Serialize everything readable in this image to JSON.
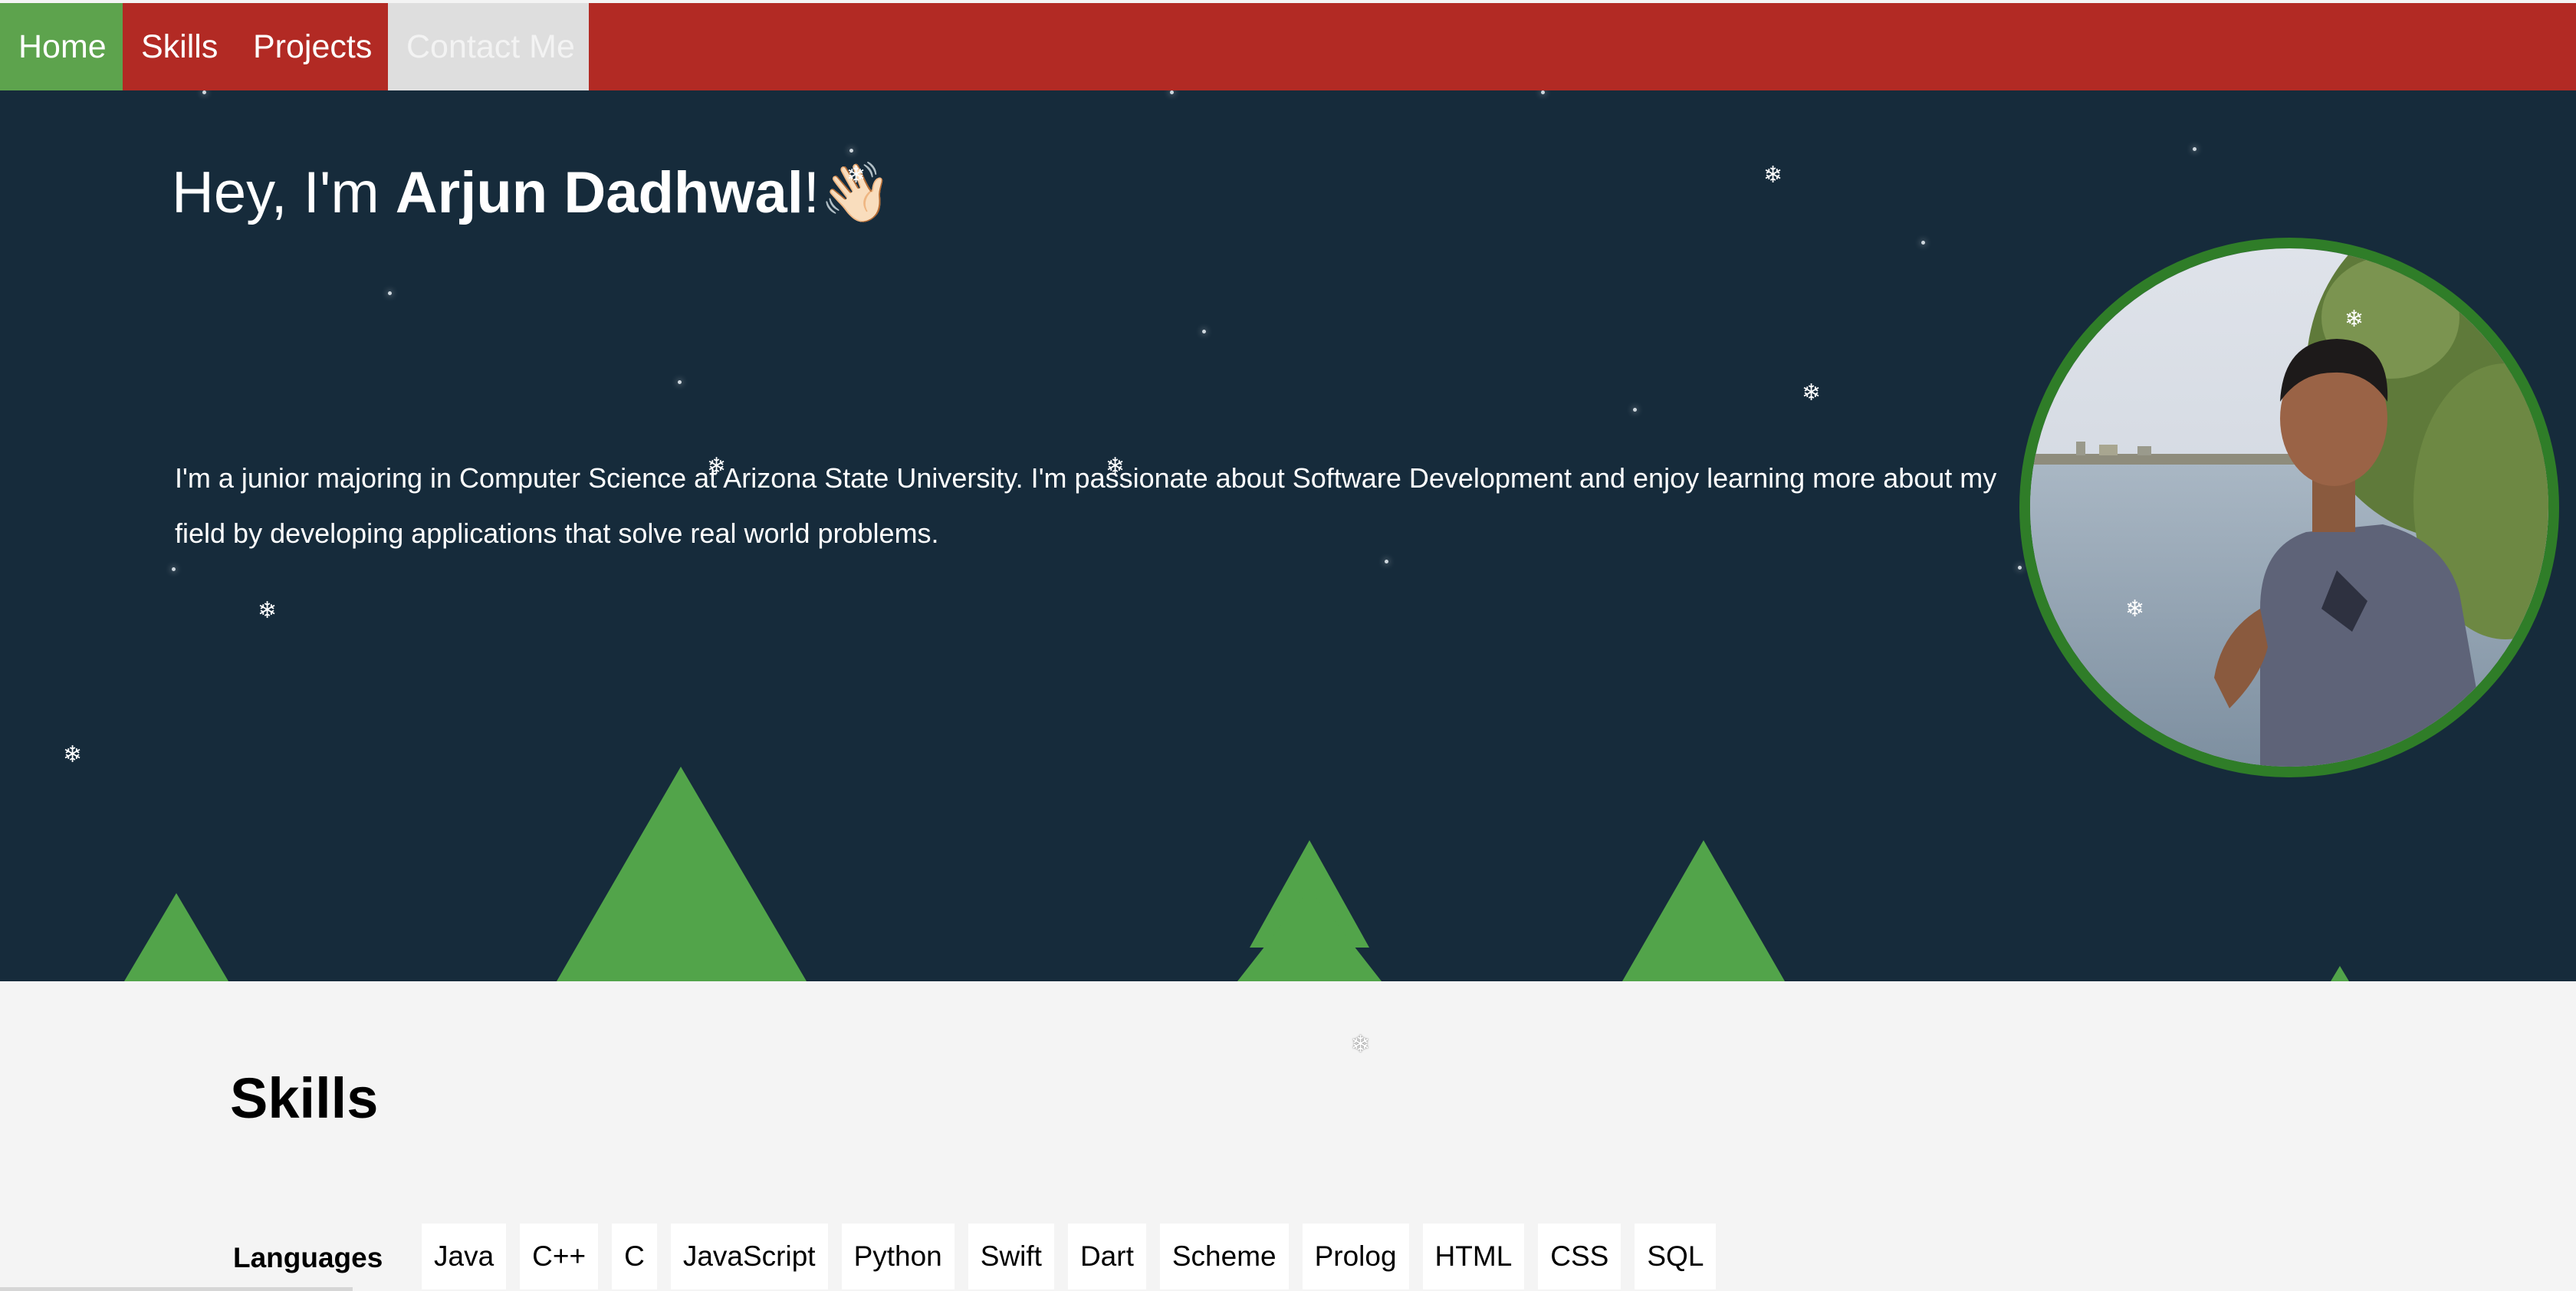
{
  "nav": {
    "home": "Home",
    "skills": "Skills",
    "projects": "Projects",
    "contact": "Contact Me"
  },
  "hero": {
    "greeting": "Hey, I'm ",
    "name": "Arjun Dadhwal",
    "exclaim": "!",
    "wave": "👋🏻",
    "bio": "I'm a junior majoring in Computer Science at Arizona State University. I'm passionate about Software Development and enjoy learning more about my field by developing applications that solve real world problems."
  },
  "skills": {
    "title": "Skills",
    "languages_label": "Languages",
    "languages": [
      "Java",
      "C++",
      "C",
      "JavaScript",
      "Python",
      "Swift",
      "Dart",
      "Scheme",
      "Prolog",
      "HTML",
      "CSS",
      "SQL"
    ]
  },
  "snowflake_glyph": "❄",
  "colors": {
    "nav_bg": "#b22a24",
    "nav_active": "#5da34d",
    "hero_bg": "#162b3b",
    "tree_green": "#52a44a",
    "avatar_ring": "#2f7d28"
  }
}
